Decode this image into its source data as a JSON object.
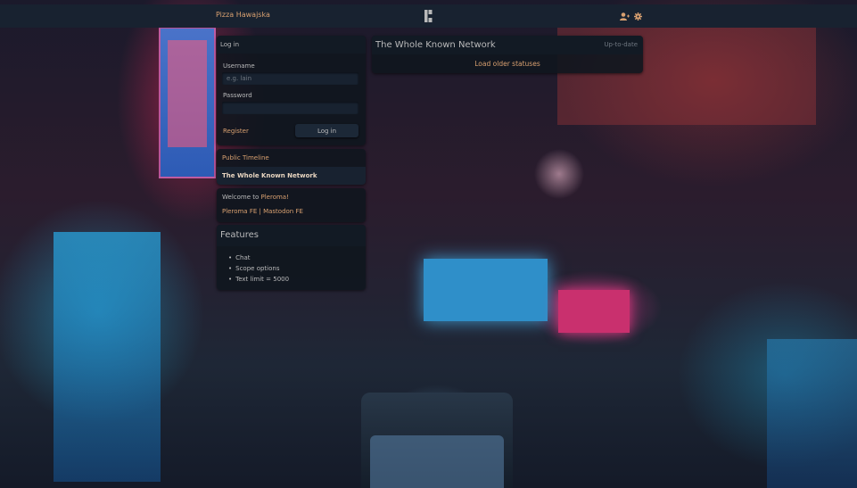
{
  "topbar": {
    "site_name": "Pizza Hawajska",
    "logo_icon": "pleroma-logo-icon",
    "icons": [
      "user-plus-icon",
      "gear-icon"
    ]
  },
  "login": {
    "title": "Log in",
    "username_label": "Username",
    "username_placeholder": "e.g. lain",
    "username_value": "",
    "password_label": "Password",
    "password_value": "",
    "register_label": "Register",
    "login_button_label": "Log in"
  },
  "nav": {
    "items": [
      {
        "label": "Public Timeline",
        "selected": false
      },
      {
        "label": "The Whole Known Network",
        "selected": true
      }
    ]
  },
  "instance": {
    "welcome_prefix": "Welcome to ",
    "welcome_link": "Pleroma!",
    "links": "Pleroma FE | Mastodon FE"
  },
  "features": {
    "title": "Features",
    "items": [
      "Chat",
      "Scope options",
      "Text limit = 5000"
    ]
  },
  "timeline": {
    "title": "The Whole Known Network",
    "status": "Up-to-date",
    "load_older_label": "Load older statuses"
  },
  "colors": {
    "accent": "#d8a070",
    "panel_bg": "#0f161e",
    "text": "#b9b9ba"
  }
}
